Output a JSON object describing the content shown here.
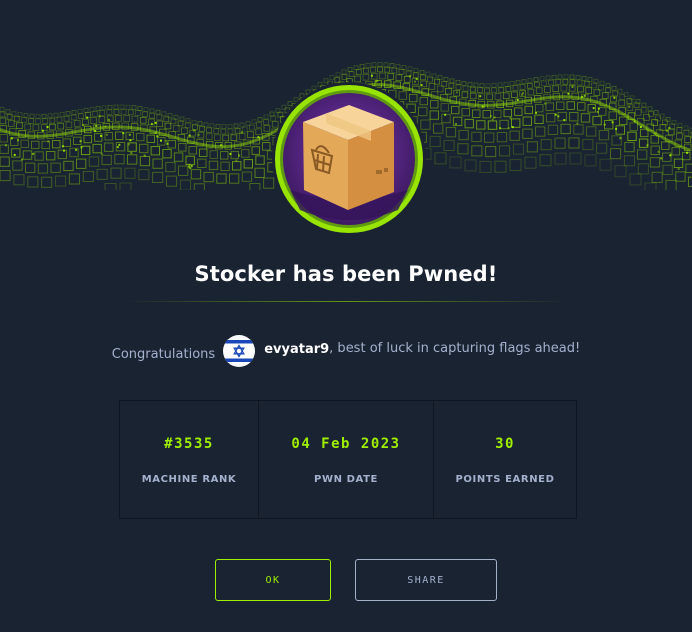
{
  "banner": {
    "accent_color": "#9fef00",
    "background_color": "#1a2332"
  },
  "badge": {
    "icon": "machine-box-icon",
    "ring_color": "#9fef00",
    "inner_color": "#5d2a8c"
  },
  "title": "Stocker has been Pwned!",
  "congrats": {
    "lead": "Congratulations",
    "avatar_icon": "israel-flag-icon",
    "username": "evyatar9",
    "message": ", best of luck in capturing flags ahead!"
  },
  "stats": [
    {
      "value": "#3535",
      "label": "MACHINE RANK"
    },
    {
      "value": "04 Feb 2023",
      "label": "PWN DATE"
    },
    {
      "value": "30",
      "label": "POINTS EARNED"
    }
  ],
  "buttons": {
    "ok": "OK",
    "share": "SHARE"
  }
}
